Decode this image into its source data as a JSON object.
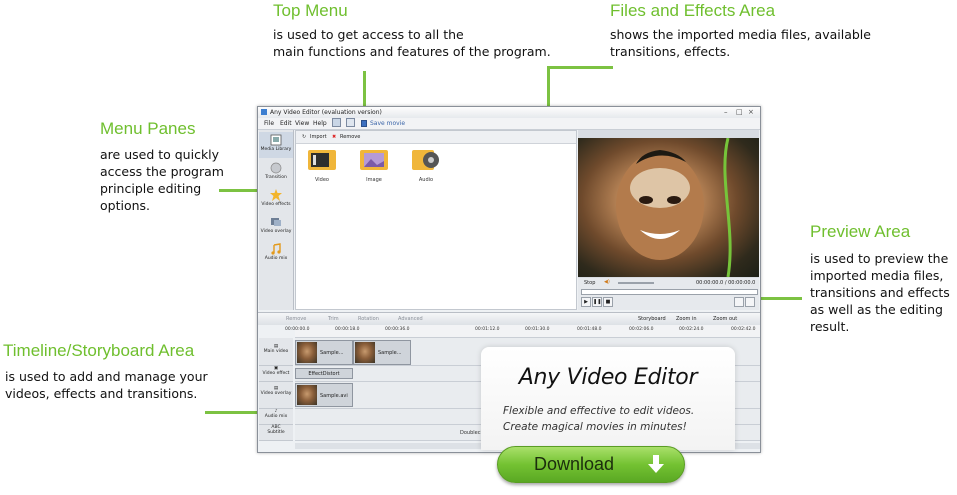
{
  "annotations": {
    "top_menu": {
      "title": "Top Menu",
      "text": [
        "is used to get access to all the",
        "main functions and features of the program."
      ]
    },
    "files_effects": {
      "title": "Files and Effects Area",
      "text": [
        "shows the imported media files, available",
        "transitions, effects."
      ]
    },
    "menu_panes": {
      "title": "Menu Panes",
      "text": [
        "are used to quickly",
        "access the program",
        "principle editing",
        "options."
      ]
    },
    "preview_area": {
      "title": "Preview Area",
      "text": [
        "is used to preview the",
        "imported media files,",
        "transitions and effects",
        "as well as the editing",
        "result."
      ]
    },
    "timeline": {
      "title": "Timeline/Storyboard Area",
      "text": [
        "is used to add and manage your",
        "videos, effects and transitions."
      ]
    }
  },
  "window": {
    "title": "Any Video Editor (evaluation version)",
    "menu": {
      "file": "File",
      "edit": "Edit",
      "view": "View",
      "help": "Help",
      "save_movie": "Save movie"
    },
    "sidebar": [
      {
        "label": "Media Library"
      },
      {
        "label": "Transition"
      },
      {
        "label": "Video effects"
      },
      {
        "label": "Video overlay"
      },
      {
        "label": "Audio mix"
      }
    ],
    "content_toolbar": {
      "import": "Import",
      "remove": "Remove"
    },
    "media_items": [
      {
        "label": "Video"
      },
      {
        "label": "Image"
      },
      {
        "label": "Audio"
      }
    ],
    "preview": {
      "stop": "Stop",
      "time": "00:00:00.0 / 00:00:00.0"
    },
    "timeline_toolbar": {
      "remove": "Remove",
      "trim": "Trim",
      "rotation": "Rotation",
      "advanced": "Advanced",
      "storyboard": "Storyboard",
      "zoom_in": "Zoom in",
      "zoom_out": "Zoom out"
    },
    "ruler": [
      "00:00:00.0",
      "00:00:18.0",
      "00:00:36.0",
      "00:01:12.0",
      "00:01:30.0",
      "00:01:48.0",
      "00:02:06.0",
      "00:02:24.0",
      "00:02:42.0",
      "00:03:00.0"
    ],
    "tracks": {
      "main_video": "Main video",
      "video_effect": "Video effect",
      "video_overlay": "Video overlay",
      "audio_mix": "Audio mix",
      "subtitle_abc": "ABC",
      "subtitle": "Subtitle",
      "clip1": "Sample...",
      "clip2": "Sample...",
      "effect": "EffectDistort",
      "overlay_clip": "Sample.avi",
      "subtitle_hint": "Doubleclick here"
    }
  },
  "promo": {
    "title": "Any Video Editor",
    "tagline1": "Flexible and effective to edit videos.",
    "tagline2": "Create magical movies in minutes!",
    "download": "Download"
  },
  "colors": {
    "accent_green": "#7cc242",
    "annotation_title": "#6fbf2e"
  }
}
